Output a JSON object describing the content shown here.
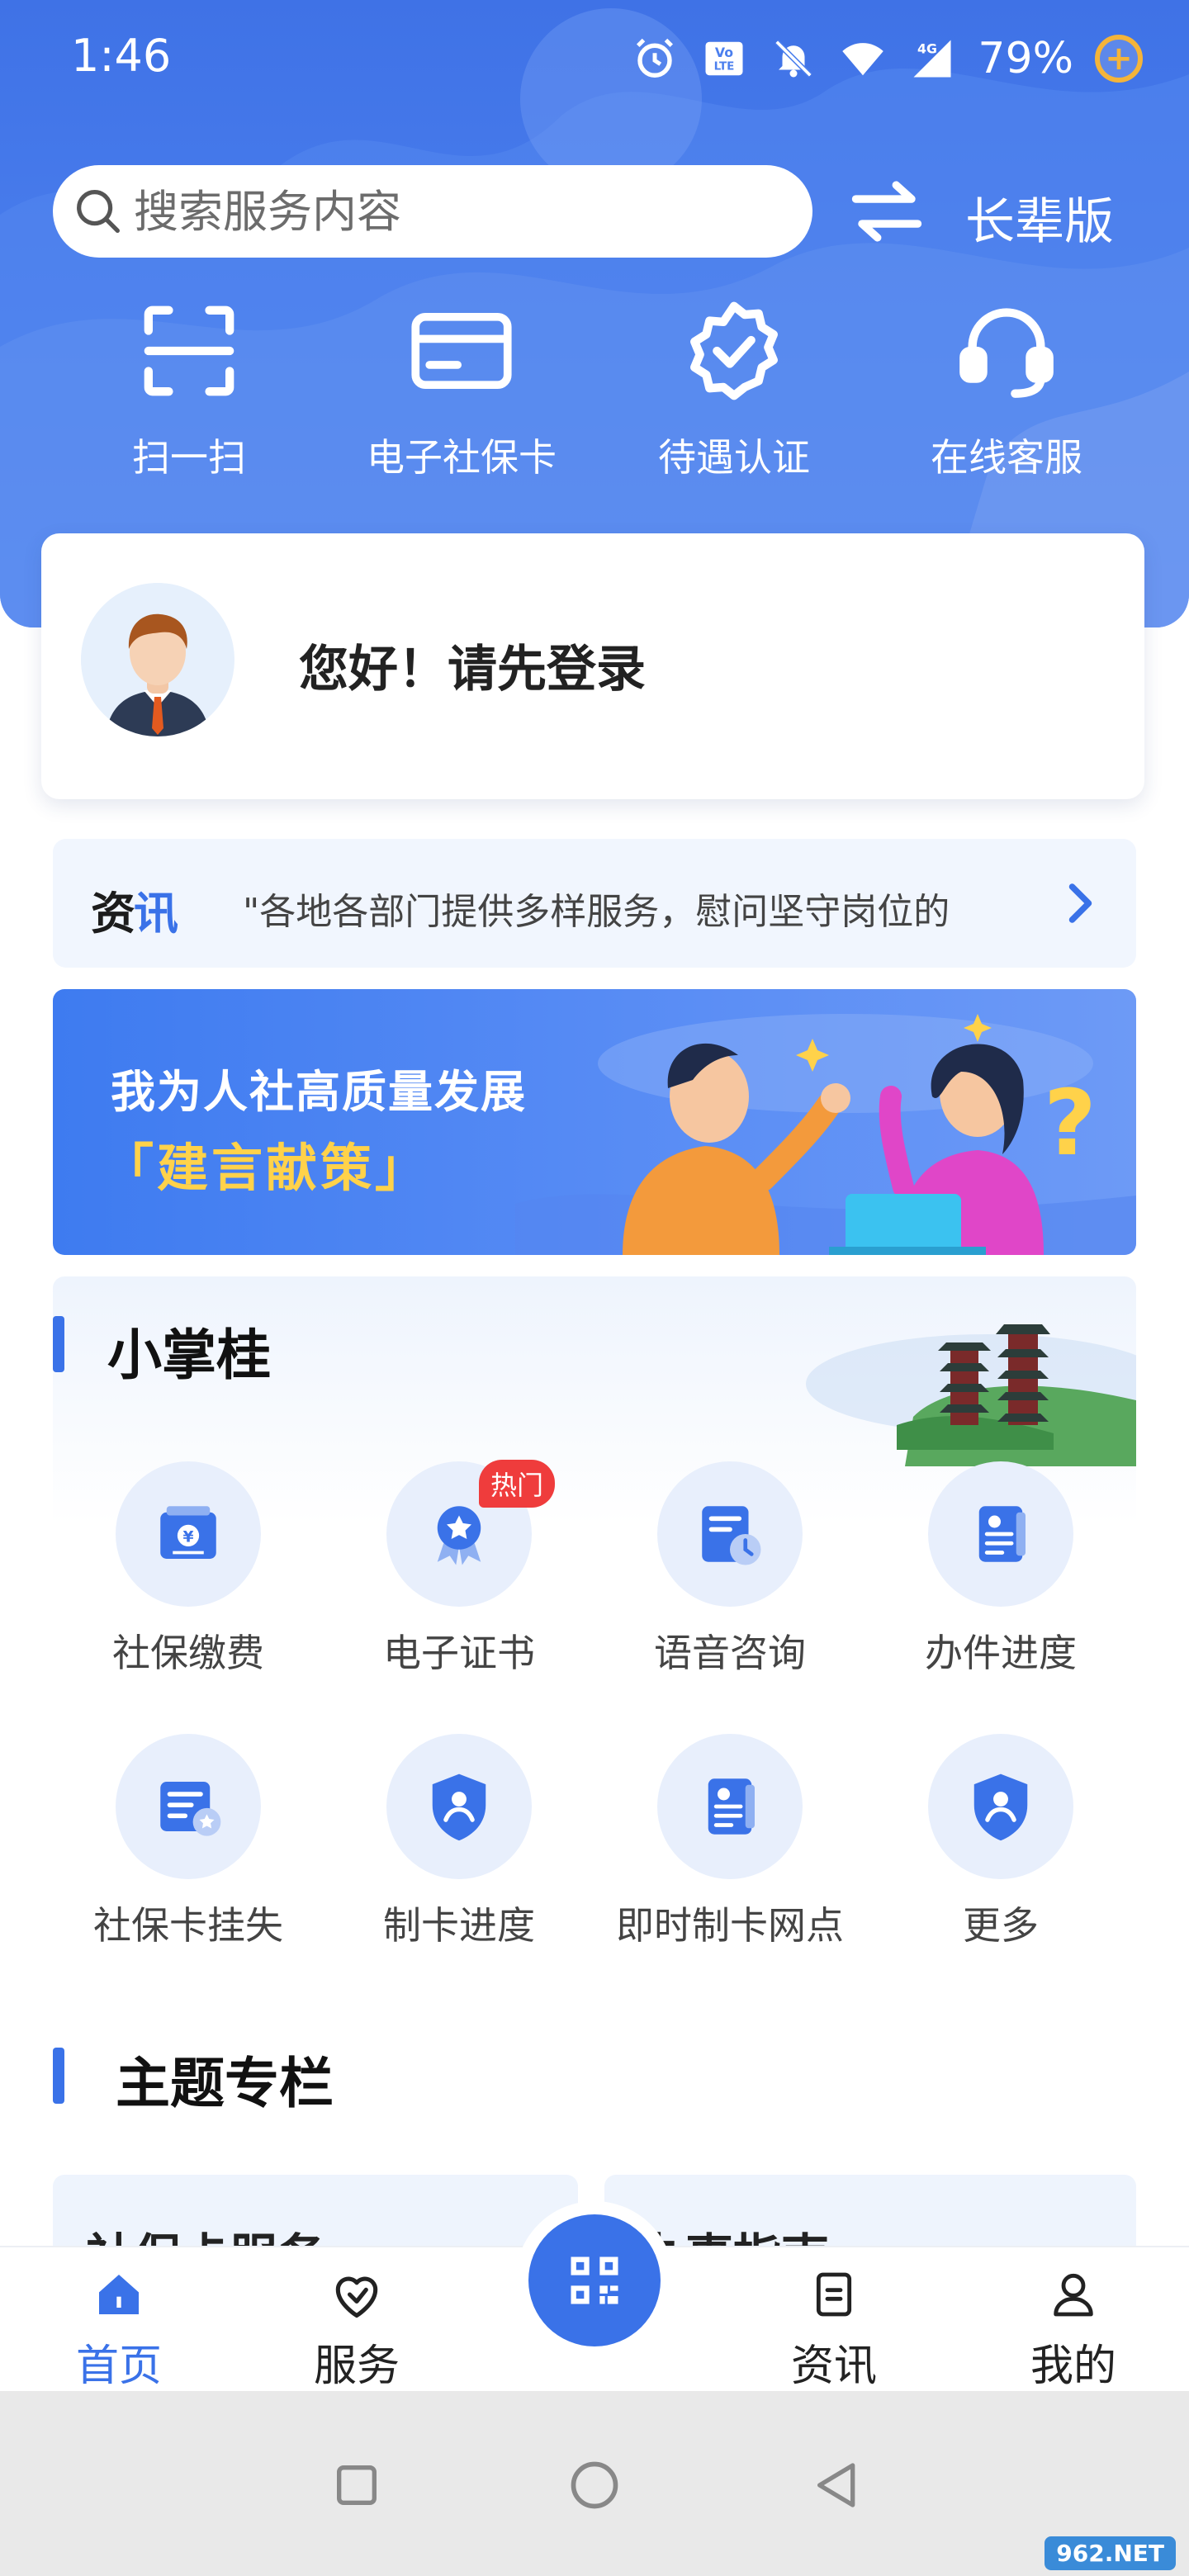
{
  "status_bar": {
    "time": "1:46",
    "battery": "79%",
    "icons": [
      "alarm-icon",
      "volte-icon",
      "mute-icon",
      "wifi-icon",
      "signal-4g-icon",
      "battery-saver-icon"
    ]
  },
  "header": {
    "search_placeholder": "搜索服务内容",
    "elder_mode_label": "长辈版"
  },
  "quick_actions": [
    {
      "label": "扫一扫",
      "icon": "scan-icon"
    },
    {
      "label": "电子社保卡",
      "icon": "card-icon"
    },
    {
      "label": "待遇认证",
      "icon": "verified-badge-icon"
    },
    {
      "label": "在线客服",
      "icon": "headset-icon"
    }
  ],
  "login_card": {
    "greeting": "您好！请先登录"
  },
  "news": {
    "tag": "资讯",
    "text": "\"各地各部门提供多样服务，慰问坚守岗位的"
  },
  "banner": {
    "line1": "我为人社高质量发展",
    "line2": "「建言献策」"
  },
  "mini_services": {
    "title": "小掌桂",
    "items": [
      {
        "label": "社保缴费",
        "icon": "payment-icon"
      },
      {
        "label": "电子证书",
        "icon": "certificate-icon",
        "badge": "热门"
      },
      {
        "label": "语音咨询",
        "icon": "voice-consult-icon"
      },
      {
        "label": "办件进度",
        "icon": "progress-doc-icon"
      },
      {
        "label": "社保卡挂失",
        "icon": "card-loss-icon"
      },
      {
        "label": "制卡进度",
        "icon": "card-progress-icon"
      },
      {
        "label": "即时制卡网点",
        "icon": "card-outlet-icon"
      },
      {
        "label": "更多",
        "icon": "more-icon"
      }
    ]
  },
  "topics": {
    "title": "主题专栏",
    "cards": [
      "社保卡服务",
      "办事指南"
    ]
  },
  "bottom_nav": [
    {
      "label": "首页",
      "icon": "home-icon",
      "active": true
    },
    {
      "label": "服务",
      "icon": "service-icon",
      "active": false
    },
    {
      "label": "资讯",
      "icon": "news-icon",
      "active": false
    },
    {
      "label": "我的",
      "icon": "profile-icon",
      "active": false
    }
  ],
  "watermark": "962.NET",
  "colors": {
    "primary": "#3a72e8",
    "hero": "#4b7fee",
    "badge": "#ef3c3c",
    "banner_highlight": "#ffd24a"
  }
}
